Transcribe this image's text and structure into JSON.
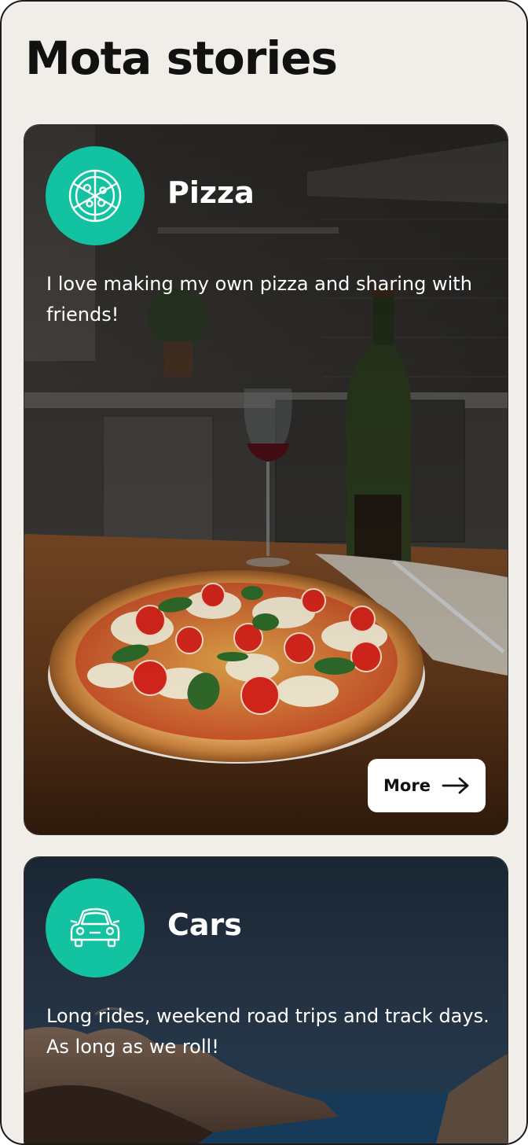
{
  "header": {
    "title": "Mota stories"
  },
  "stories": [
    {
      "title": "Pizza",
      "description": "I love making my own pizza and sharing with friends!",
      "icon": "pizza-icon",
      "more_label": "More"
    },
    {
      "title": "Cars",
      "description": "Long rides, weekend road trips and track days. As long as we roll!",
      "icon": "car-icon"
    }
  ],
  "colors": {
    "accent": "#13c2a0",
    "page_background": "#f1eee9",
    "text_dark": "#111111"
  }
}
